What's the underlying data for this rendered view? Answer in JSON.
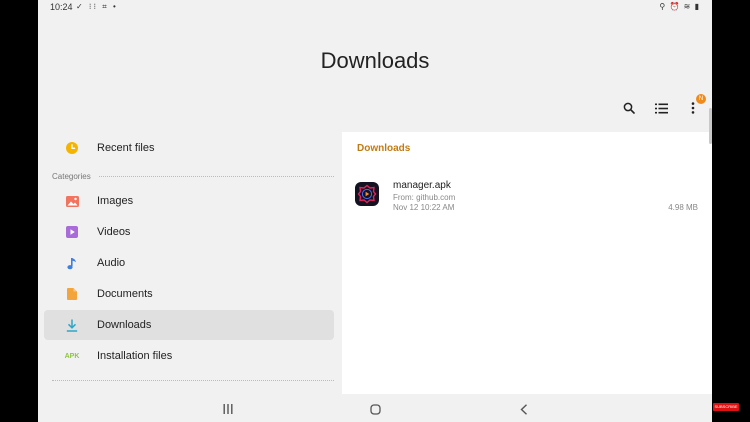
{
  "status_bar": {
    "time": "10:24",
    "left_icons": "✓ ⁝⁝ ⌗ •",
    "right_icons": "⚲ ⏰ ≋ ▮"
  },
  "title": "Downloads",
  "toolbar": {
    "badge": "N"
  },
  "sidebar": {
    "recent_label": "Recent files",
    "section_label": "Categories",
    "items": [
      {
        "label": "Images",
        "icon": "image-icon",
        "color": "#f2745f"
      },
      {
        "label": "Videos",
        "icon": "video-icon",
        "color": "#a86bd8"
      },
      {
        "label": "Audio",
        "icon": "audio-icon",
        "color": "#3f7fe0"
      },
      {
        "label": "Documents",
        "icon": "document-icon",
        "color": "#f3a43b"
      },
      {
        "label": "Downloads",
        "icon": "download-icon",
        "color": "#2ba7c8"
      },
      {
        "label": "Installation files",
        "icon": "apk-icon",
        "color": "#8cc63e",
        "icon_text": "APK"
      }
    ],
    "active_item": "Downloads"
  },
  "content": {
    "header": "Downloads",
    "files": [
      {
        "name": "manager.apk",
        "source": "From: github.com",
        "date": "Nov 12 10:22 AM",
        "size": "4.98 MB"
      }
    ]
  },
  "watermark": "SUBSCRIBE",
  "colors": {
    "accent": "#c27b13",
    "badge": "#f08a1c",
    "recent_icon": "#f5b400"
  }
}
